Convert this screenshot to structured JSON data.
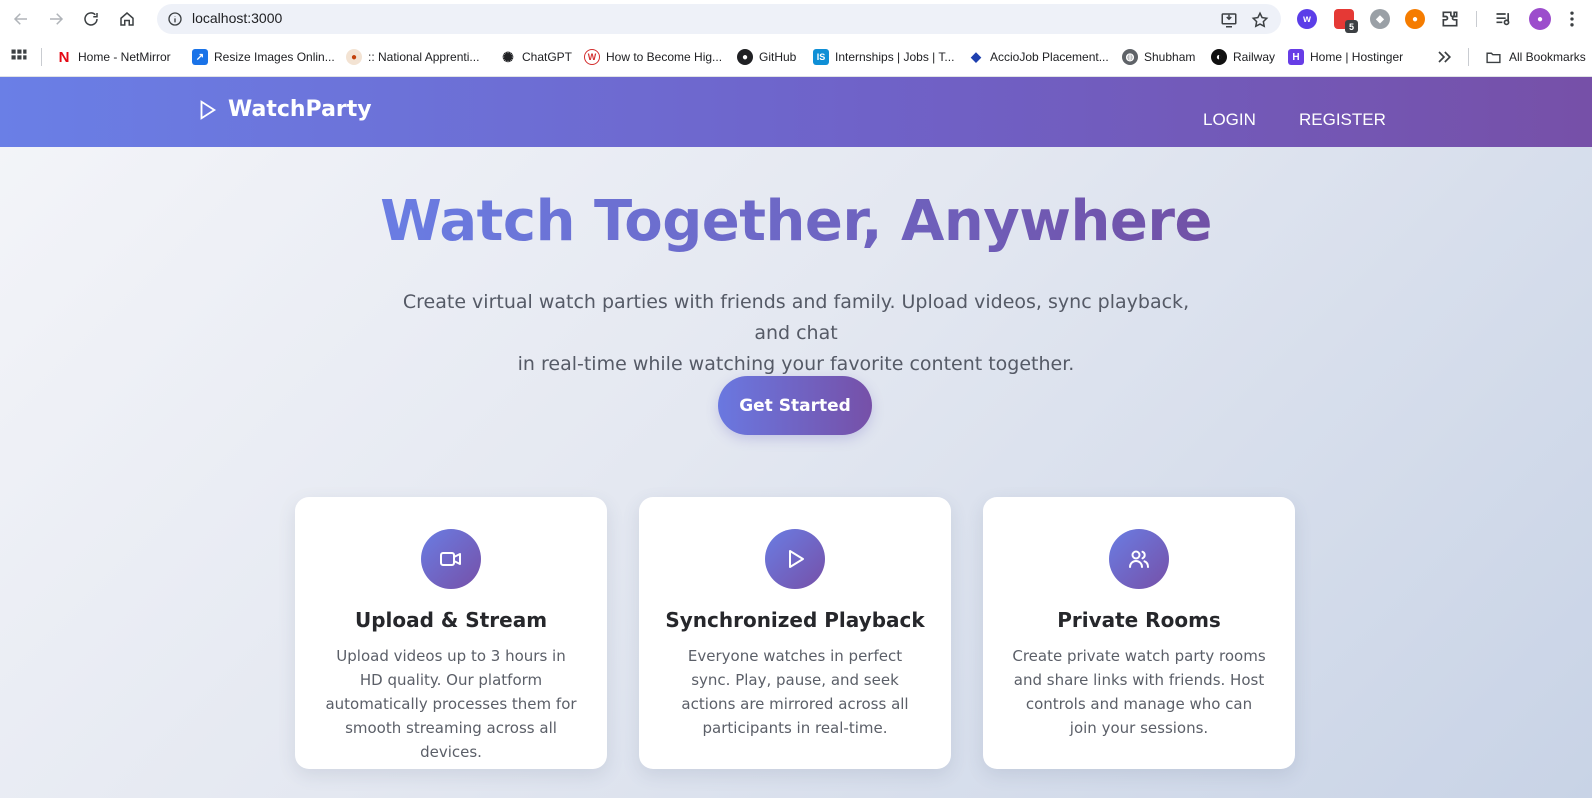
{
  "browser": {
    "url": "localhost:3000",
    "extension_badge": "5",
    "bookmarks": [
      {
        "label": "Home - NetMirror",
        "icon": "netmirror-icon",
        "color": "#e50914"
      },
      {
        "label": "Resize Images Onlin...",
        "icon": "resize-icon",
        "color": "#1a73e8"
      },
      {
        "label": ":: National Apprenti...",
        "icon": "apprentice-icon",
        "color": "#c2410c"
      },
      {
        "label": "ChatGPT",
        "icon": "chatgpt-icon",
        "color": "#202124"
      },
      {
        "label": "How to Become Hig...",
        "icon": "w-icon",
        "color": "#d32f2f"
      },
      {
        "label": "GitHub",
        "icon": "github-icon",
        "color": "#202124"
      },
      {
        "label": "Internships | Jobs | T...",
        "icon": "internshala-icon",
        "color": "#0f8fd6"
      },
      {
        "label": "AccioJob Placement...",
        "icon": "acciojob-icon",
        "color": "#1e40af"
      },
      {
        "label": "Shubham",
        "icon": "globe-icon",
        "color": "#3c4043"
      },
      {
        "label": "Railway",
        "icon": "railway-icon",
        "color": "#111111"
      },
      {
        "label": "Home | Hostinger",
        "icon": "hostinger-icon",
        "color": "#673de6"
      }
    ],
    "all_bookmarks_label": "All Bookmarks"
  },
  "header": {
    "brand": "WatchParty",
    "login": "LOGIN",
    "register": "REGISTER"
  },
  "hero": {
    "title": "Watch Together, Anywhere",
    "subtitle_line1": "Create virtual watch parties with friends and family. Upload videos, sync playback, and chat",
    "subtitle_line2": "in real-time while watching your favorite content together.",
    "cta": "Get Started"
  },
  "features": [
    {
      "icon": "video-camera-icon",
      "title": "Upload & Stream",
      "description": "Upload videos up to 3 hours in HD quality. Our platform automatically processes them for smooth streaming across all devices."
    },
    {
      "icon": "play-icon",
      "title": "Synchronized Playback",
      "description": "Everyone watches in perfect sync. Play, pause, and seek actions are mirrored across all participants in real-time."
    },
    {
      "icon": "users-icon",
      "title": "Private Rooms",
      "description": "Create private watch party rooms and share links with friends. Host controls and manage who can join your sessions."
    }
  ],
  "colors": {
    "accent_start": "#6a7de3",
    "accent_end": "#7650a8"
  }
}
